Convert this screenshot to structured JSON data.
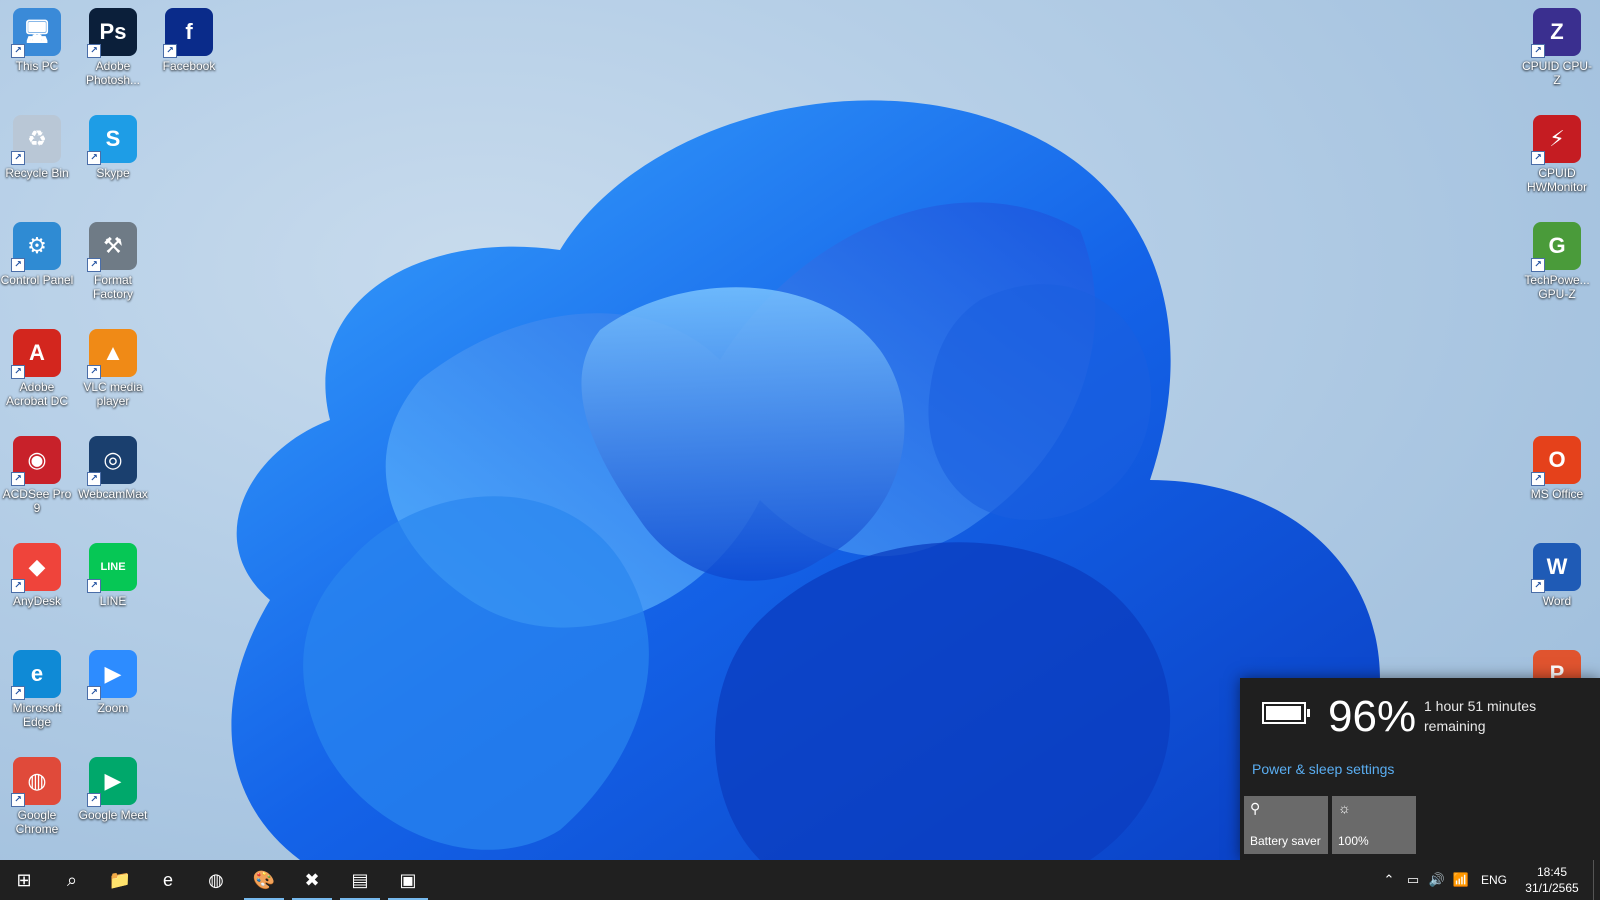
{
  "desktop_icons": {
    "left": [
      {
        "label": "This PC",
        "icon": "computer-icon",
        "color": "#3a8ad8",
        "glyph": "🖥"
      },
      {
        "label": "Adobe Photosh...",
        "icon": "photoshop-icon",
        "color": "#0b1f3a",
        "glyph": "Ps"
      },
      {
        "label": "Facebook",
        "icon": "facebook-icon",
        "color": "#0a2b8a",
        "glyph": "f"
      },
      {
        "label": "Recycle Bin",
        "icon": "recycle-bin-icon",
        "color": "#b9c7d6",
        "glyph": "♻"
      },
      {
        "label": "Skype",
        "icon": "skype-icon",
        "color": "#1e9de6",
        "glyph": "S"
      },
      {
        "label": "Control Panel",
        "icon": "control-panel-icon",
        "color": "#2f8bd3",
        "glyph": "⚙"
      },
      {
        "label": "Format Factory",
        "icon": "format-factory-icon",
        "color": "#6f7b86",
        "glyph": "⚒"
      },
      {
        "label": "Adobe Acrobat DC",
        "icon": "acrobat-icon",
        "color": "#d3261e",
        "glyph": "A"
      },
      {
        "label": "VLC media player",
        "icon": "vlc-icon",
        "color": "#f08a16",
        "glyph": "▲"
      },
      {
        "label": "ACDSee Pro 9",
        "icon": "acdsee-icon",
        "color": "#c8212a",
        "glyph": "◉"
      },
      {
        "label": "WebcamMax",
        "icon": "webcammax-icon",
        "color": "#1a3f6e",
        "glyph": "◎"
      },
      {
        "label": "AnyDesk",
        "icon": "anydesk-icon",
        "color": "#ef443b",
        "glyph": "◆"
      },
      {
        "label": "LINE",
        "icon": "line-icon",
        "color": "#06c755",
        "glyph": "LINE"
      },
      {
        "label": "Microsoft Edge",
        "icon": "edge-icon",
        "color": "#0f8ad6",
        "glyph": "e"
      },
      {
        "label": "Zoom",
        "icon": "zoom-icon",
        "color": "#2d8cff",
        "glyph": "▶"
      },
      {
        "label": "Google Chrome",
        "icon": "chrome-icon",
        "color": "#e04a3a",
        "glyph": "◍"
      },
      {
        "label": "Google Meet",
        "icon": "google-meet-icon",
        "color": "#00a86b",
        "glyph": "▶"
      }
    ],
    "right": [
      {
        "label": "CPUID CPU-Z",
        "icon": "cpuz-icon",
        "color": "#3a2f8f",
        "glyph": "Z"
      },
      {
        "label": "CPUID HWMonitor",
        "icon": "hwmonitor-icon",
        "color": "#c51c22",
        "glyph": "⚡"
      },
      {
        "label": "TechPowe... GPU-Z",
        "icon": "gpuz-icon",
        "color": "#4a9b3a",
        "glyph": "G"
      },
      {
        "label": "MS Office",
        "icon": "office-icon",
        "color": "#e5411b",
        "glyph": "O"
      },
      {
        "label": "Word",
        "icon": "word-icon",
        "color": "#1f5bb6",
        "glyph": "W"
      },
      {
        "label": "",
        "icon": "powerpoint-icon",
        "color": "#e0542f",
        "glyph": "P"
      }
    ]
  },
  "battery_flyout": {
    "percent_text": "96%",
    "percent_value": 0.96,
    "remaining": "1 hour 51 minutes remaining",
    "power_settings_link": "Power & sleep settings",
    "tiles": [
      {
        "label": "Battery saver",
        "icon": "battery-saver-icon",
        "glyph": "⚲"
      },
      {
        "label": "100%",
        "icon": "brightness-icon",
        "glyph": "☼"
      }
    ]
  },
  "taskbar": {
    "items": [
      {
        "name": "start-button",
        "glyph": "⊞",
        "running": false
      },
      {
        "name": "search-button",
        "glyph": "⌕",
        "running": false
      },
      {
        "name": "file-explorer-button",
        "glyph": "📁",
        "running": false
      },
      {
        "name": "edge-button",
        "glyph": "e",
        "running": false
      },
      {
        "name": "chrome-button",
        "glyph": "◍",
        "running": false
      },
      {
        "name": "paint-button",
        "glyph": "🎨",
        "running": true
      },
      {
        "name": "app-x-button",
        "glyph": "✖",
        "running": true
      },
      {
        "name": "app-tool-button",
        "glyph": "▤",
        "running": true
      },
      {
        "name": "app-monitor-button",
        "glyph": "▣",
        "running": true
      }
    ],
    "tray": {
      "language": "ENG",
      "time": "18:45",
      "date": "31/1/2565"
    }
  }
}
